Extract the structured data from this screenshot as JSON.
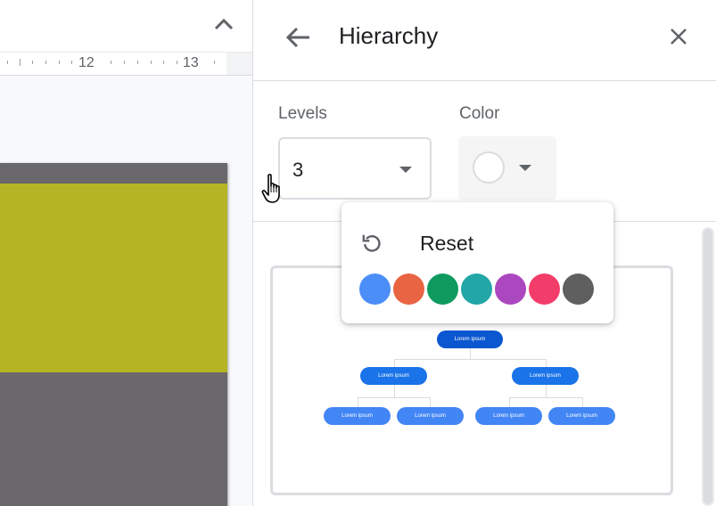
{
  "ruler": {
    "labels": [
      "12",
      "13"
    ]
  },
  "panel": {
    "title": "Hierarchy"
  },
  "options": {
    "levels_label": "Levels",
    "levels_value": "3",
    "color_label": "Color"
  },
  "color_menu": {
    "reset_label": "Reset",
    "swatches": [
      "#4c8ef7",
      "#e96442",
      "#0f9a5f",
      "#23a6a6",
      "#ac48bf",
      "#f23d6b",
      "#5f5f5f"
    ]
  },
  "preview": {
    "nodes": [
      "Lorem ipsum",
      "Lorem ipsum",
      "Lorem ipsum",
      "Lorem ipsum",
      "Lorem ipsum",
      "Lorem ipsum",
      "Lorem ipsum"
    ]
  },
  "colors": {
    "slide_accent": "#b4b424",
    "slide_base": "#6a686a",
    "node_root": "#0b57d0",
    "node_level2": "#1a73e8",
    "node_level3": "#4285f4"
  },
  "icons": [
    "chevron-up-icon",
    "back-arrow-icon",
    "close-icon",
    "reset-icon",
    "dropdown-caret-icon",
    "hand-cursor-icon"
  ]
}
